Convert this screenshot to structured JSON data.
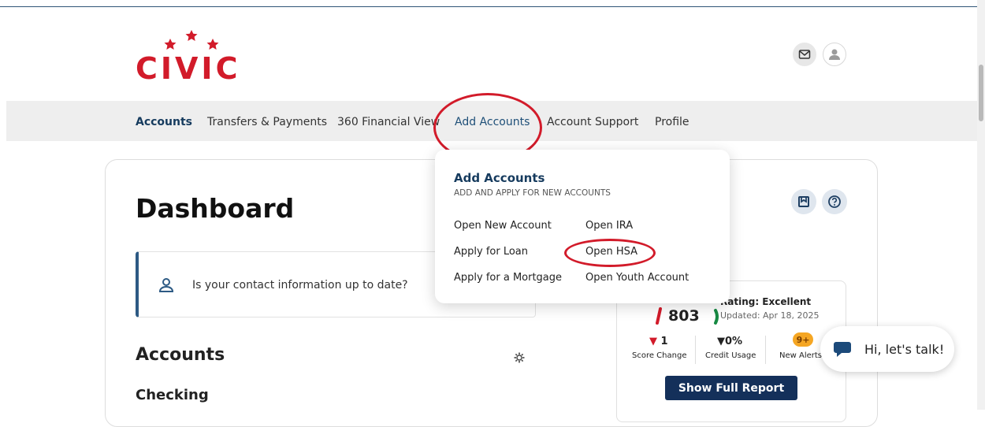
{
  "brand": {
    "name": "CIVIC"
  },
  "header": {
    "mail_icon": "envelope-icon",
    "user_icon": "user-icon"
  },
  "nav": {
    "items": [
      {
        "label": "Accounts"
      },
      {
        "label": "Transfers & Payments"
      },
      {
        "label": "360 Financial View"
      },
      {
        "label": "Add Accounts"
      },
      {
        "label": "Account Support"
      },
      {
        "label": "Profile"
      }
    ]
  },
  "dropdown": {
    "title": "Add Accounts",
    "subtitle": "ADD AND APPLY FOR NEW ACCOUNTS",
    "col1": [
      "Open New Account",
      "Apply for Loan",
      "Apply for a Mortgage"
    ],
    "col2": [
      "Open IRA",
      "Open HSA",
      "Open Youth Account"
    ]
  },
  "dashboard": {
    "title": "Dashboard",
    "contact_prompt": "Is your contact information up to date?",
    "accounts_heading": "Accounts",
    "checking_heading": "Checking"
  },
  "credit": {
    "score": "803",
    "rating": "Rating: Excellent",
    "updated": "Updated: Apr 18, 2025",
    "score_change_value": "1",
    "score_change_label": "Score Change",
    "credit_usage_value": "0%",
    "credit_usage_label": "Credit Usage",
    "alerts_badge": "9+",
    "alerts_label": "New Alerts",
    "report_button": "Show Full Report"
  },
  "chat": {
    "label": "Hi, let's talk!"
  },
  "colors": {
    "brand_red": "#d21b2a",
    "navy": "#14305a",
    "highlight_ring": "#d21b2a"
  }
}
